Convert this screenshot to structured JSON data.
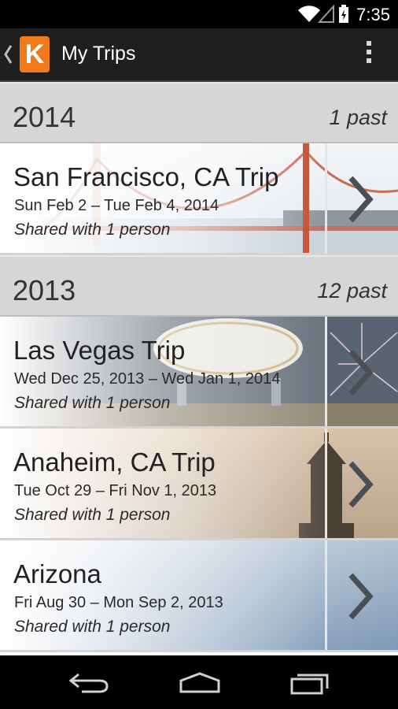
{
  "status_bar": {
    "time": "7:35"
  },
  "app_bar": {
    "logo_letter": "K",
    "title": "My Trips"
  },
  "sections": [
    {
      "year": "2014",
      "past": "1 past",
      "trips": [
        {
          "title": "San Francisco, CA Trip",
          "dates": "Sun Feb 2 – Tue Feb 4, 2014",
          "shared": "Shared with 1 person"
        }
      ]
    },
    {
      "year": "2013",
      "past": "12 past",
      "trips": [
        {
          "title": "Las Vegas Trip",
          "dates": "Wed Dec 25, 2013 – Wed Jan 1, 2014",
          "shared": "Shared with 1 person"
        },
        {
          "title": "Anaheim, CA Trip",
          "dates": "Tue Oct 29 – Fri Nov 1, 2013",
          "shared": "Shared with 1 person"
        },
        {
          "title": "Arizona",
          "dates": "Fri Aug 30 – Mon Sep 2, 2013",
          "shared": "Shared with 1 person"
        }
      ]
    }
  ],
  "colors": {
    "accent": "#f07a1a",
    "action_bar": "#1f1f1f",
    "section_header": "#d6d6d6"
  }
}
